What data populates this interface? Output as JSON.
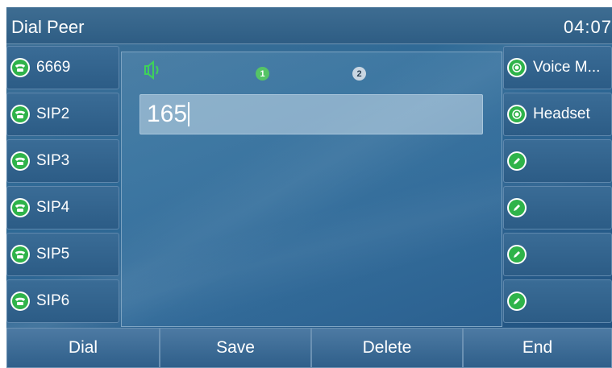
{
  "titlebar": {
    "title": "Dial Peer",
    "time": "04:07"
  },
  "line_keys_left": [
    {
      "label": "6669",
      "icon": "phone-icon"
    },
    {
      "label": "SIP2",
      "icon": "phone-icon"
    },
    {
      "label": "SIP3",
      "icon": "phone-icon"
    },
    {
      "label": "SIP4",
      "icon": "phone-icon"
    },
    {
      "label": "SIP5",
      "icon": "phone-icon"
    },
    {
      "label": "SIP6",
      "icon": "phone-icon"
    }
  ],
  "line_keys_right": [
    {
      "label": "Voice M...",
      "icon": "radio-icon"
    },
    {
      "label": "Headset",
      "icon": "radio-icon"
    },
    {
      "label": "",
      "icon": "edit-icon"
    },
    {
      "label": "",
      "icon": "edit-icon"
    },
    {
      "label": "",
      "icon": "edit-icon"
    },
    {
      "label": "",
      "icon": "edit-icon"
    }
  ],
  "dial": {
    "accounts": [
      "1",
      "2"
    ],
    "number": "165"
  },
  "softkeys": {
    "dial": "Dial",
    "save": "Save",
    "delete": "Delete",
    "end": "End"
  },
  "colors": {
    "accent_green": "#2fb34a",
    "background": "#2b6391"
  }
}
